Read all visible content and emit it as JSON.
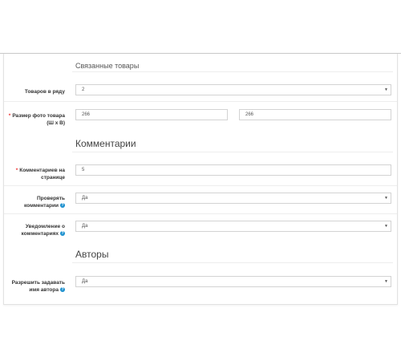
{
  "related": {
    "title": "Связанные товары",
    "per_row_label": "Товаров в ряду",
    "per_row_value": "2",
    "photo_size_label": "Размер фото товара (Ш x В)",
    "photo_width": "266",
    "photo_height": "266"
  },
  "comments": {
    "title": "Комментарии",
    "per_page_label": "Комментариев на странице",
    "per_page_value": "5",
    "moderate_label": "Проверять комментарии",
    "moderate_value": "Да",
    "notify_label": "Уведомление о комментариях",
    "notify_value": "Да"
  },
  "authors": {
    "title": "Авторы",
    "allow_name_label": "Разрешить задавать имя автора",
    "allow_name_value": "Да"
  },
  "icons": {
    "required": "*",
    "help": "?",
    "caret": "▼"
  }
}
